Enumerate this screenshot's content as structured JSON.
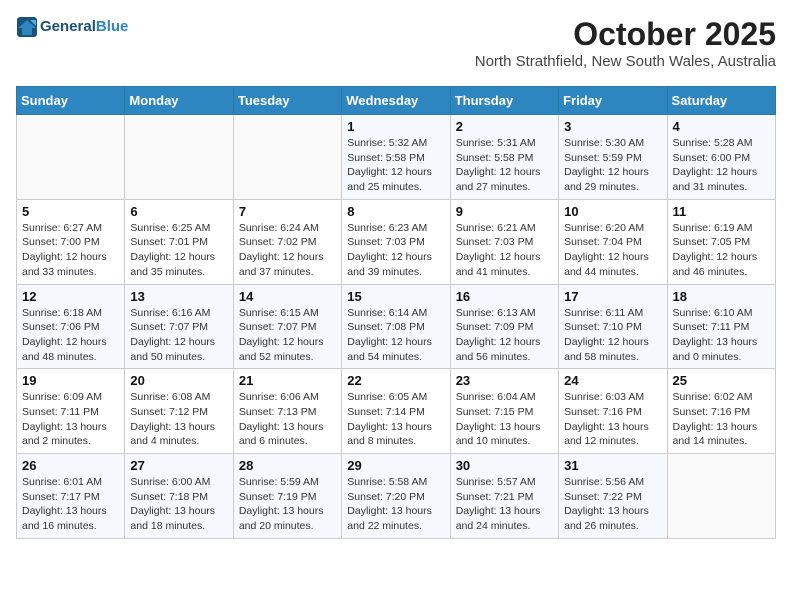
{
  "header": {
    "logo_line1": "General",
    "logo_line2": "Blue",
    "month_title": "October 2025",
    "location": "North Strathfield, New South Wales, Australia"
  },
  "weekdays": [
    "Sunday",
    "Monday",
    "Tuesday",
    "Wednesday",
    "Thursday",
    "Friday",
    "Saturday"
  ],
  "weeks": [
    [
      {
        "day": "",
        "info": ""
      },
      {
        "day": "",
        "info": ""
      },
      {
        "day": "",
        "info": ""
      },
      {
        "day": "1",
        "info": "Sunrise: 5:32 AM\nSunset: 5:58 PM\nDaylight: 12 hours\nand 25 minutes."
      },
      {
        "day": "2",
        "info": "Sunrise: 5:31 AM\nSunset: 5:58 PM\nDaylight: 12 hours\nand 27 minutes."
      },
      {
        "day": "3",
        "info": "Sunrise: 5:30 AM\nSunset: 5:59 PM\nDaylight: 12 hours\nand 29 minutes."
      },
      {
        "day": "4",
        "info": "Sunrise: 5:28 AM\nSunset: 6:00 PM\nDaylight: 12 hours\nand 31 minutes."
      }
    ],
    [
      {
        "day": "5",
        "info": "Sunrise: 6:27 AM\nSunset: 7:00 PM\nDaylight: 12 hours\nand 33 minutes."
      },
      {
        "day": "6",
        "info": "Sunrise: 6:25 AM\nSunset: 7:01 PM\nDaylight: 12 hours\nand 35 minutes."
      },
      {
        "day": "7",
        "info": "Sunrise: 6:24 AM\nSunset: 7:02 PM\nDaylight: 12 hours\nand 37 minutes."
      },
      {
        "day": "8",
        "info": "Sunrise: 6:23 AM\nSunset: 7:03 PM\nDaylight: 12 hours\nand 39 minutes."
      },
      {
        "day": "9",
        "info": "Sunrise: 6:21 AM\nSunset: 7:03 PM\nDaylight: 12 hours\nand 41 minutes."
      },
      {
        "day": "10",
        "info": "Sunrise: 6:20 AM\nSunset: 7:04 PM\nDaylight: 12 hours\nand 44 minutes."
      },
      {
        "day": "11",
        "info": "Sunrise: 6:19 AM\nSunset: 7:05 PM\nDaylight: 12 hours\nand 46 minutes."
      }
    ],
    [
      {
        "day": "12",
        "info": "Sunrise: 6:18 AM\nSunset: 7:06 PM\nDaylight: 12 hours\nand 48 minutes."
      },
      {
        "day": "13",
        "info": "Sunrise: 6:16 AM\nSunset: 7:07 PM\nDaylight: 12 hours\nand 50 minutes."
      },
      {
        "day": "14",
        "info": "Sunrise: 6:15 AM\nSunset: 7:07 PM\nDaylight: 12 hours\nand 52 minutes."
      },
      {
        "day": "15",
        "info": "Sunrise: 6:14 AM\nSunset: 7:08 PM\nDaylight: 12 hours\nand 54 minutes."
      },
      {
        "day": "16",
        "info": "Sunrise: 6:13 AM\nSunset: 7:09 PM\nDaylight: 12 hours\nand 56 minutes."
      },
      {
        "day": "17",
        "info": "Sunrise: 6:11 AM\nSunset: 7:10 PM\nDaylight: 12 hours\nand 58 minutes."
      },
      {
        "day": "18",
        "info": "Sunrise: 6:10 AM\nSunset: 7:11 PM\nDaylight: 13 hours\nand 0 minutes."
      }
    ],
    [
      {
        "day": "19",
        "info": "Sunrise: 6:09 AM\nSunset: 7:11 PM\nDaylight: 13 hours\nand 2 minutes."
      },
      {
        "day": "20",
        "info": "Sunrise: 6:08 AM\nSunset: 7:12 PM\nDaylight: 13 hours\nand 4 minutes."
      },
      {
        "day": "21",
        "info": "Sunrise: 6:06 AM\nSunset: 7:13 PM\nDaylight: 13 hours\nand 6 minutes."
      },
      {
        "day": "22",
        "info": "Sunrise: 6:05 AM\nSunset: 7:14 PM\nDaylight: 13 hours\nand 8 minutes."
      },
      {
        "day": "23",
        "info": "Sunrise: 6:04 AM\nSunset: 7:15 PM\nDaylight: 13 hours\nand 10 minutes."
      },
      {
        "day": "24",
        "info": "Sunrise: 6:03 AM\nSunset: 7:16 PM\nDaylight: 13 hours\nand 12 minutes."
      },
      {
        "day": "25",
        "info": "Sunrise: 6:02 AM\nSunset: 7:16 PM\nDaylight: 13 hours\nand 14 minutes."
      }
    ],
    [
      {
        "day": "26",
        "info": "Sunrise: 6:01 AM\nSunset: 7:17 PM\nDaylight: 13 hours\nand 16 minutes."
      },
      {
        "day": "27",
        "info": "Sunrise: 6:00 AM\nSunset: 7:18 PM\nDaylight: 13 hours\nand 18 minutes."
      },
      {
        "day": "28",
        "info": "Sunrise: 5:59 AM\nSunset: 7:19 PM\nDaylight: 13 hours\nand 20 minutes."
      },
      {
        "day": "29",
        "info": "Sunrise: 5:58 AM\nSunset: 7:20 PM\nDaylight: 13 hours\nand 22 minutes."
      },
      {
        "day": "30",
        "info": "Sunrise: 5:57 AM\nSunset: 7:21 PM\nDaylight: 13 hours\nand 24 minutes."
      },
      {
        "day": "31",
        "info": "Sunrise: 5:56 AM\nSunset: 7:22 PM\nDaylight: 13 hours\nand 26 minutes."
      },
      {
        "day": "",
        "info": ""
      }
    ]
  ]
}
